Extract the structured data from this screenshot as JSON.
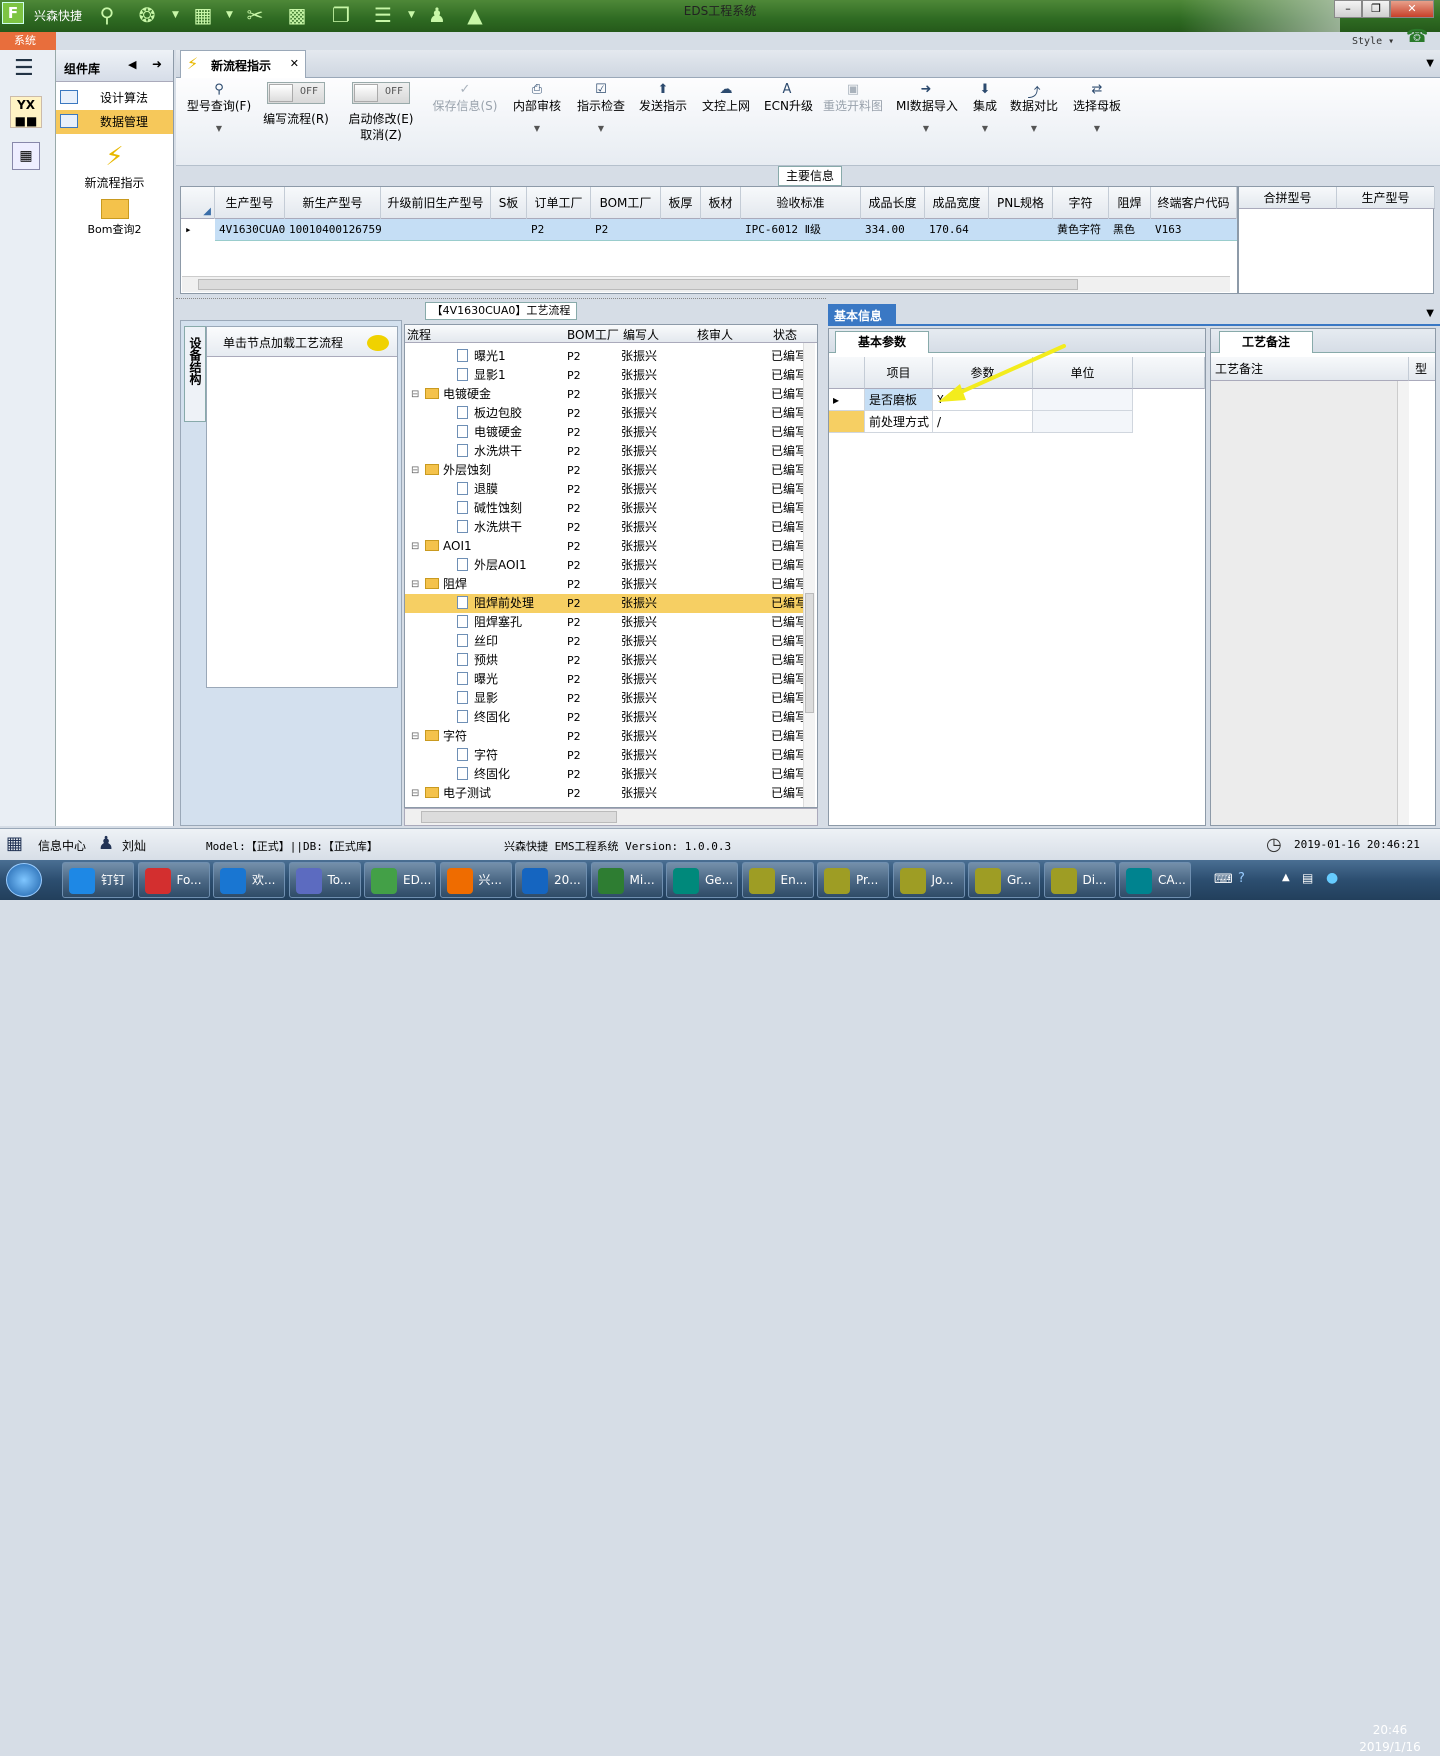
{
  "window": {
    "app_short": "兴森快捷",
    "title": "EDS工程系统",
    "style_label": "Style",
    "system_tab": "系统"
  },
  "component_panel": {
    "title": "组件库",
    "items": [
      {
        "label": "设计算法"
      },
      {
        "label": "数据管理"
      }
    ],
    "launchers": [
      {
        "label": "新流程指示"
      },
      {
        "label": "Bom查询2"
      }
    ]
  },
  "doc_tab": {
    "label": "新流程指示"
  },
  "ribbon": {
    "buttons": [
      {
        "label": "型号查询(F)"
      },
      {
        "label": "编写流程(R)",
        "toggle": "OFF"
      },
      {
        "label": "启动修改(E)",
        "label2": "取消(Z)",
        "toggle": "OFF"
      },
      {
        "label": "保存信息(S)"
      },
      {
        "label": "内部审核"
      },
      {
        "label": "指示检查"
      },
      {
        "label": "发送指示"
      },
      {
        "label": "文控上网"
      },
      {
        "label": "ECN升级"
      },
      {
        "label": "重选开料图"
      },
      {
        "label": "MI数据导入"
      },
      {
        "label": "集成"
      },
      {
        "label": "数据对比"
      },
      {
        "label": "选择母板"
      }
    ]
  },
  "main_info": {
    "title": "主要信息",
    "columns": [
      "生产型号",
      "新生产型号",
      "升级前旧生产型号",
      "S板",
      "订单工厂",
      "BOM工厂",
      "板厚",
      "板材",
      "验收标准",
      "成品长度",
      "成品宽度",
      "PNL规格",
      "字符",
      "阻焊",
      "终端客户代码"
    ],
    "row": [
      "4V1630CUA0",
      "10010400126759",
      "",
      "",
      "P2",
      "P2",
      "",
      "",
      "IPC-6012 Ⅱ级",
      "334.00",
      "170.64",
      "",
      "黄色字符",
      "黑色",
      "V163"
    ],
    "right_columns": [
      "合拼型号",
      "生产型号"
    ]
  },
  "process": {
    "title": "【4V1630CUA0】工艺流程",
    "side_tab": "设备结构",
    "click_hint": "单击节点加载工艺流程",
    "columns": [
      "流程",
      "BOM工厂",
      "编写人",
      "核审人",
      "状态"
    ],
    "rows": [
      {
        "name": "曝光1",
        "level": 2,
        "bom": "P2",
        "writer": "张振兴",
        "reviewer": "",
        "status": "已编写"
      },
      {
        "name": "显影1",
        "level": 2,
        "bom": "P2",
        "writer": "张振兴",
        "reviewer": "",
        "status": "已编写"
      },
      {
        "name": "电镀硬金",
        "level": 1,
        "bom": "P2",
        "writer": "张振兴",
        "reviewer": "",
        "status": "已编写"
      },
      {
        "name": "板边包胶",
        "level": 2,
        "bom": "P2",
        "writer": "张振兴",
        "reviewer": "",
        "status": "已编写"
      },
      {
        "name": "电镀硬金",
        "level": 2,
        "bom": "P2",
        "writer": "张振兴",
        "reviewer": "",
        "status": "已编写"
      },
      {
        "name": "水洗烘干",
        "level": 2,
        "bom": "P2",
        "writer": "张振兴",
        "reviewer": "",
        "status": "已编写"
      },
      {
        "name": "外层蚀刻",
        "level": 1,
        "bom": "P2",
        "writer": "张振兴",
        "reviewer": "",
        "status": "已编写"
      },
      {
        "name": "退膜",
        "level": 2,
        "bom": "P2",
        "writer": "张振兴",
        "reviewer": "",
        "status": "已编写"
      },
      {
        "name": "碱性蚀刻",
        "level": 2,
        "bom": "P2",
        "writer": "张振兴",
        "reviewer": "",
        "status": "已编写"
      },
      {
        "name": "水洗烘干",
        "level": 2,
        "bom": "P2",
        "writer": "张振兴",
        "reviewer": "",
        "status": "已编写"
      },
      {
        "name": "AOI1",
        "level": 1,
        "bom": "P2",
        "writer": "张振兴",
        "reviewer": "",
        "status": "已编写"
      },
      {
        "name": "外层AOI1",
        "level": 2,
        "bom": "P2",
        "writer": "张振兴",
        "reviewer": "",
        "status": "已编写"
      },
      {
        "name": "阻焊",
        "level": 1,
        "bom": "P2",
        "writer": "张振兴",
        "reviewer": "",
        "status": "已编写"
      },
      {
        "name": "阻焊前处理",
        "level": 2,
        "bom": "P2",
        "writer": "张振兴",
        "reviewer": "",
        "status": "已编写",
        "selected": true
      },
      {
        "name": "阻焊塞孔",
        "level": 2,
        "bom": "P2",
        "writer": "张振兴",
        "reviewer": "",
        "status": "已编写"
      },
      {
        "name": "丝印",
        "level": 2,
        "bom": "P2",
        "writer": "张振兴",
        "reviewer": "",
        "status": "已编写"
      },
      {
        "name": "预烘",
        "level": 2,
        "bom": "P2",
        "writer": "张振兴",
        "reviewer": "",
        "status": "已编写"
      },
      {
        "name": "曝光",
        "level": 2,
        "bom": "P2",
        "writer": "张振兴",
        "reviewer": "",
        "status": "已编写"
      },
      {
        "name": "显影",
        "level": 2,
        "bom": "P2",
        "writer": "张振兴",
        "reviewer": "",
        "status": "已编写"
      },
      {
        "name": "终固化",
        "level": 2,
        "bom": "P2",
        "writer": "张振兴",
        "reviewer": "",
        "status": "已编写"
      },
      {
        "name": "字符",
        "level": 1,
        "bom": "P2",
        "writer": "张振兴",
        "reviewer": "",
        "status": "已编写"
      },
      {
        "name": "字符",
        "level": 2,
        "bom": "P2",
        "writer": "张振兴",
        "reviewer": "",
        "status": "已编写"
      },
      {
        "name": "终固化",
        "level": 2,
        "bom": "P2",
        "writer": "张振兴",
        "reviewer": "",
        "status": "已编写"
      },
      {
        "name": "电子测试",
        "level": 1,
        "bom": "P2",
        "writer": "张振兴",
        "reviewer": "",
        "status": "已编写"
      }
    ]
  },
  "basic_info": {
    "tab": "基本信息",
    "param_tab": "基本参数",
    "columns": [
      "项目",
      "参数",
      "单位"
    ],
    "rows": [
      {
        "item": "是否磨板",
        "value": "Y",
        "unit": ""
      },
      {
        "item": "前处理方式",
        "value": "/",
        "unit": ""
      }
    ]
  },
  "remarks": {
    "tab": "工艺备注",
    "columns": [
      "工艺备注",
      "型"
    ]
  },
  "status": {
    "info_center": "信息中心",
    "user": "刘灿",
    "model": "Model:【正式】||DB:【正式库】",
    "version": "兴森快捷 EMS工程系统 Version: 1.0.0.3",
    "datetime": "2019-01-16 20:46:21"
  },
  "taskbar": {
    "items": [
      {
        "label": "钉钉",
        "color": "#1e88e5"
      },
      {
        "label": "Fo...",
        "color": "#d32f2f"
      },
      {
        "label": "欢...",
        "color": "#1976d2"
      },
      {
        "label": "To...",
        "color": "#5c6bc0"
      },
      {
        "label": "ED...",
        "color": "#43a047"
      },
      {
        "label": "兴...",
        "color": "#ef6c00"
      },
      {
        "label": "20...",
        "color": "#1565c0"
      },
      {
        "label": "Mi...",
        "color": "#2e7d32"
      },
      {
        "label": "Ge...",
        "color": "#00897b"
      },
      {
        "label": "En...",
        "color": "#9e9d24"
      },
      {
        "label": "Pr...",
        "color": "#9e9d24"
      },
      {
        "label": "Jo...",
        "color": "#9e9d24"
      },
      {
        "label": "Gr...",
        "color": "#9e9d24"
      },
      {
        "label": "Di...",
        "color": "#9e9d24"
      },
      {
        "label": "CA...",
        "color": "#00838f"
      }
    ],
    "time": "20:46",
    "date": "2019/1/16"
  }
}
